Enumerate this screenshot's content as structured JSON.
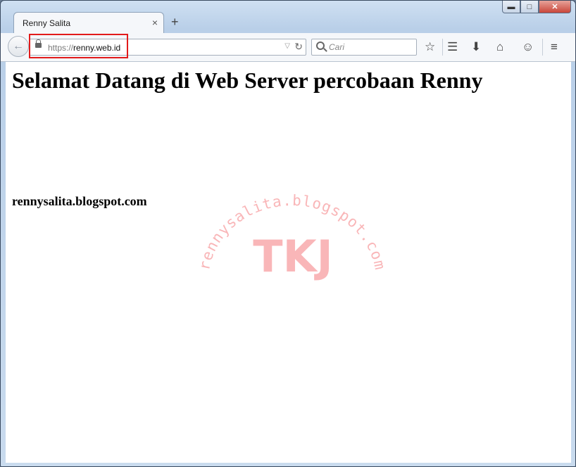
{
  "tab": {
    "title": "Renny Salita",
    "close": "×",
    "new_tab": "+"
  },
  "window_controls": {
    "minimize": "▬",
    "maximize": "□",
    "close": "✕"
  },
  "address": {
    "scheme": "https://",
    "host": "renny.web.id"
  },
  "search": {
    "placeholder": "Cari"
  },
  "page": {
    "heading": "Selamat Datang di Web Server percobaan Renny",
    "blog_name": "rennysalita.blogspot.com"
  },
  "watermark": {
    "arc_text": "rennysalita.blogspot.com",
    "center_text": "TKJ",
    "color": "#f9b6b8"
  },
  "highlight_color": "#e21b1b"
}
